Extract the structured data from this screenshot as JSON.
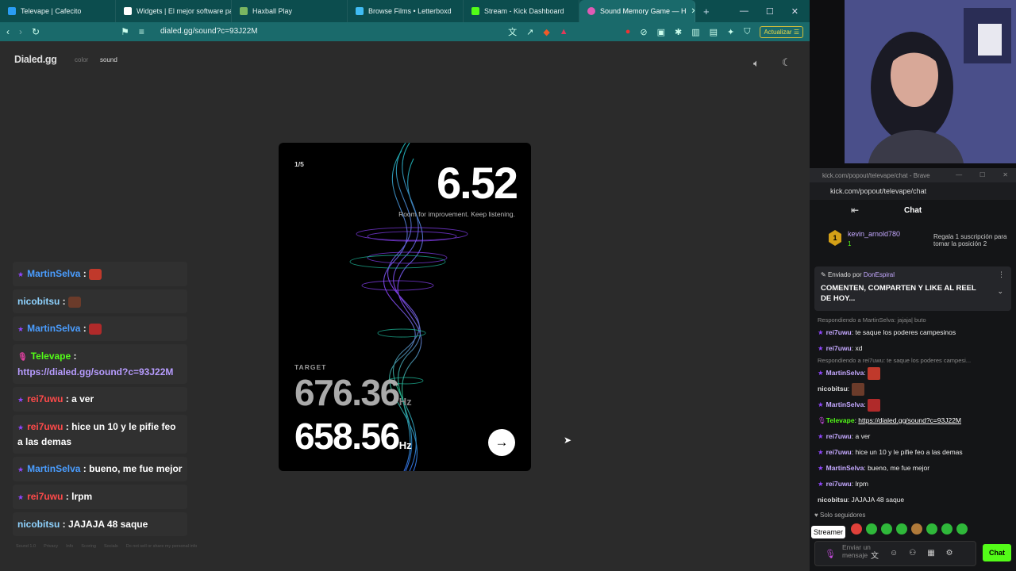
{
  "tabs": [
    {
      "label": "Televape | Cafecito",
      "color": "#2a9df4"
    },
    {
      "label": "Widgets | El mejor software para",
      "color": "#ffffff"
    },
    {
      "label": "Haxball Play",
      "color": "#7bb661"
    },
    {
      "label": "Browse Films • Letterboxd",
      "color": "#40bcf4"
    },
    {
      "label": "Stream - Kick Dashboard",
      "color": "#53fc18"
    },
    {
      "label": "Sound Memory Game — H",
      "color": "#e05bb5"
    }
  ],
  "address": {
    "url": "dialed.gg/sound?c=93J22M",
    "update_label": "Actualizar"
  },
  "site": {
    "logo": "Dialed.gg",
    "nav_color": "color",
    "nav_sound": "sound"
  },
  "game": {
    "round": "1/5",
    "score": "6.52",
    "feedback": "Room for improvement. Keep listening.",
    "target_label": "TARGET",
    "target_value": "676.36",
    "guess_value": "658.56",
    "unit": "Hz",
    "accent": "#9b59ff"
  },
  "footer": [
    "Sound 1.0",
    "Privacy",
    "Info",
    "Scoring",
    "Socials",
    "Do not sell or share my personal info"
  ],
  "overlay": {
    "messages": [
      {
        "user": "MartinSelva",
        "color": "#4a9dff",
        "icon": "star",
        "text": "",
        "emote": "#c0392b"
      },
      {
        "user": "nicobitsu",
        "color": "#8fd3ff",
        "icon": "",
        "text": "",
        "emote": "#6b3b2a"
      },
      {
        "user": "MartinSelva",
        "color": "#4a9dff",
        "icon": "star",
        "text": "",
        "emote": "#b02a2a"
      },
      {
        "user": "Televape",
        "color": "#53fc18",
        "icon": "mic",
        "text": "https://dialed.gg/sound?c=93J22M",
        "link": true
      },
      {
        "user": "rei7uwu",
        "color": "#ff4a4a",
        "icon": "star",
        "text": "a ver"
      },
      {
        "user": "rei7uwu",
        "color": "#ff4a4a",
        "icon": "star",
        "text": "hice un 10 y le pifie feo a las demas"
      },
      {
        "user": "MartinSelva",
        "color": "#4a9dff",
        "icon": "star",
        "text": "bueno, me fue mejor"
      },
      {
        "user": "rei7uwu",
        "color": "#ff4a4a",
        "icon": "star",
        "text": "lrpm"
      },
      {
        "user": "nicobitsu",
        "color": "#8fd3ff",
        "icon": "",
        "text": "JAJAJA 48 saque"
      }
    ]
  },
  "popup": {
    "title": "kick.com/popout/televape/chat - Brave",
    "url": "kick.com/popout/televape/chat",
    "chat_title": "Chat",
    "top_gifter": {
      "rank": "1",
      "name": "kevin_arnold780",
      "count": "1",
      "gift_text": "Regala 1 suscripción para tomar la posición 2"
    },
    "pinned": {
      "by_label": "Enviado por",
      "by_user": "DonEspiral",
      "text": "COMENTEN, COMPARTEN Y LIKE AL REEL DE HOY..."
    },
    "messages": [
      {
        "reply": "Respondiendo a MartinSelva: jajaja| buto"
      },
      {
        "user": "rei7uwu",
        "color": "#c4a8ff",
        "icon": "star",
        "text": "te saque los poderes campesinos"
      },
      {
        "user": "rei7uwu",
        "color": "#c4a8ff",
        "icon": "star",
        "text": "xd"
      },
      {
        "reply": "Respondiendo a rei7uwu: te saque los poderes campesi..."
      },
      {
        "user": "MartinSelva",
        "color": "#c4a8ff",
        "icon": "star",
        "text": "",
        "emote": "#c0392b"
      },
      {
        "user": "nicobitsu",
        "color": "#dddddd",
        "icon": "",
        "text": "",
        "emote": "#6b3b2a"
      },
      {
        "user": "MartinSelva",
        "color": "#c4a8ff",
        "icon": "star",
        "text": "",
        "emote": "#b02a2a"
      },
      {
        "user": "Televape",
        "color": "#53fc18",
        "icon": "mic",
        "text": "https://dialed.gg/sound?c=93J22M",
        "link": true
      },
      {
        "user": "rei7uwu",
        "color": "#c4a8ff",
        "icon": "star",
        "text": "a ver"
      },
      {
        "user": "rei7uwu",
        "color": "#c4a8ff",
        "icon": "star",
        "text": "hice un 10 y le pifie feo a las demas"
      },
      {
        "user": "MartinSelva",
        "color": "#c4a8ff",
        "icon": "star",
        "text": "bueno, me fue mejor"
      },
      {
        "user": "rei7uwu",
        "color": "#c4a8ff",
        "icon": "star",
        "text": "lrpm"
      },
      {
        "user": "nicobitsu",
        "color": "#dddddd",
        "icon": "",
        "text": "JAJAJA 48 saque"
      }
    ],
    "followers_only": "Solo seguidores",
    "streamer_label": "Streamer",
    "input_placeholder": "Enviar un mensaje",
    "send_label": "Chat"
  }
}
